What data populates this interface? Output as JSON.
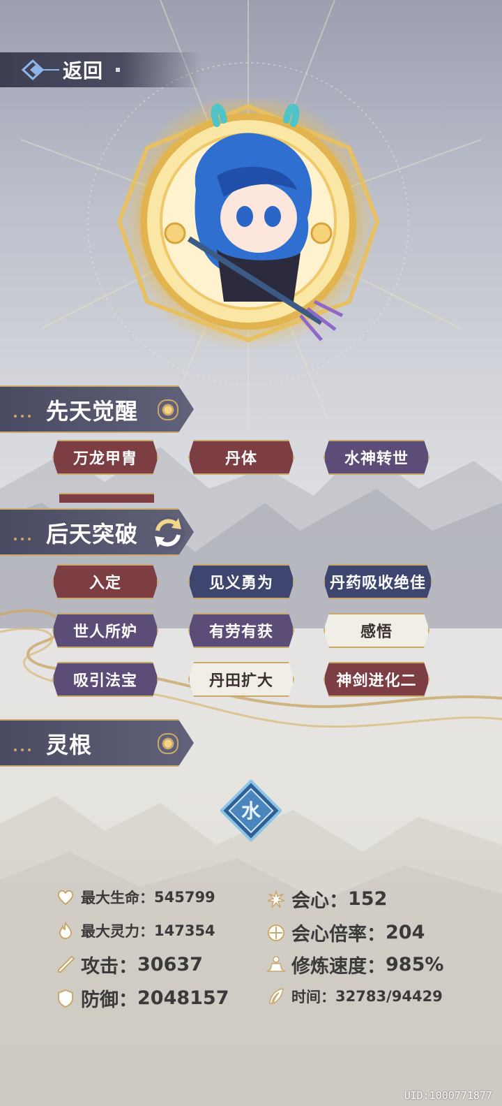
{
  "header": {
    "back_label": "返回"
  },
  "sections": {
    "innate": {
      "title": "先天觉醒"
    },
    "acquired": {
      "title": "后天突破"
    },
    "root": {
      "title": "灵根"
    }
  },
  "innate_tags": [
    "万龙甲胄",
    "丹体",
    "水神转世"
  ],
  "acquired_tags": [
    "入定",
    "见义勇为",
    "丹药吸收绝佳",
    "世人所妒",
    "有劳有获",
    "感悟",
    "吸引法宝",
    "丹田扩大",
    "神剑进化二"
  ],
  "root": {
    "element": "水",
    "icon": "water-root-icon"
  },
  "stats": {
    "hp_label": "最大生命：",
    "hp_value": "545799",
    "mp_label": "最大灵力：",
    "mp_value": "147354",
    "atk_label": "攻击：",
    "atk_value": "30637",
    "def_label": "防御：",
    "def_value": "2048157",
    "crit_label": "会心：",
    "crit_value": "152",
    "critmult_label": "会心倍率：",
    "critmult_value": "204",
    "speed_label": "修炼速度：",
    "speed_value": "985%",
    "time_label": "时间：",
    "time_value": "32783/94429"
  },
  "uid": "UID:1000771877",
  "colors": {
    "gold": "#c9a86a",
    "tag_red": "#7c3e42",
    "tag_purple": "#5b4c78",
    "tag_navy": "#3e4670",
    "tag_light": "#f1efe5"
  }
}
